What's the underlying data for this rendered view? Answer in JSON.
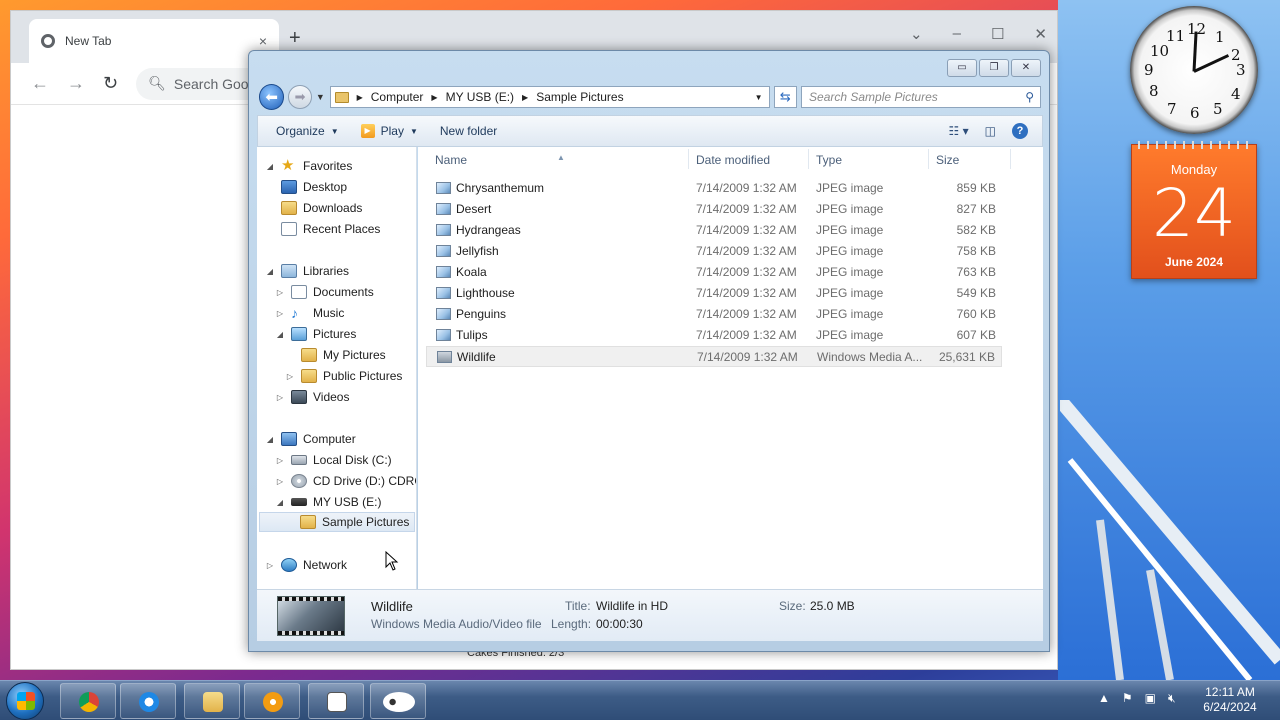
{
  "chrome": {
    "tab_title": "New Tab",
    "tab_close": "×",
    "new_tab": "+",
    "omnibox_placeholder": "Search Google",
    "status_text": "Cakes Finished: 2/3"
  },
  "explorer": {
    "breadcrumb": [
      "Computer",
      "MY USB (E:)",
      "Sample Pictures"
    ],
    "search_placeholder": "Search Sample Pictures",
    "toolbar": {
      "organize_label": "Organize",
      "play_label": "Play",
      "new_folder_label": "New folder"
    },
    "nav_tree": [
      {
        "label": "Favorites",
        "icon": "star-icon"
      },
      {
        "label": "Desktop",
        "icon": "desktop-icon"
      },
      {
        "label": "Downloads",
        "icon": "folder-icon"
      },
      {
        "label": "Recent Places",
        "icon": "recent-places-icon"
      },
      {
        "label": "Libraries",
        "icon": "library-icon"
      },
      {
        "label": "Documents",
        "icon": "document-icon"
      },
      {
        "label": "Music",
        "icon": "music-icon"
      },
      {
        "label": "Pictures",
        "icon": "pictures-icon"
      },
      {
        "label": "My Pictures",
        "icon": "folder-icon"
      },
      {
        "label": "Public Pictures",
        "icon": "folder-icon"
      },
      {
        "label": "Videos",
        "icon": "video-icon"
      },
      {
        "label": "Computer",
        "icon": "computer-icon"
      },
      {
        "label": "Local Disk (C:)",
        "icon": "drive-icon"
      },
      {
        "label": "CD Drive (D:) CDROM",
        "icon": "cd-icon"
      },
      {
        "label": "MY USB (E:)",
        "icon": "usb-drive-icon"
      },
      {
        "label": "Sample Pictures",
        "icon": "folder-icon"
      },
      {
        "label": "Network",
        "icon": "network-icon"
      }
    ],
    "columns": {
      "name": "Name",
      "date": "Date modified",
      "type": "Type",
      "size": "Size"
    },
    "files": [
      {
        "name": "Chrysanthemum",
        "date": "7/14/2009 1:32 AM",
        "type": "JPEG image",
        "size": "859 KB"
      },
      {
        "name": "Desert",
        "date": "7/14/2009 1:32 AM",
        "type": "JPEG image",
        "size": "827 KB"
      },
      {
        "name": "Hydrangeas",
        "date": "7/14/2009 1:32 AM",
        "type": "JPEG image",
        "size": "582 KB"
      },
      {
        "name": "Jellyfish",
        "date": "7/14/2009 1:32 AM",
        "type": "JPEG image",
        "size": "758 KB"
      },
      {
        "name": "Koala",
        "date": "7/14/2009 1:32 AM",
        "type": "JPEG image",
        "size": "763 KB"
      },
      {
        "name": "Lighthouse",
        "date": "7/14/2009 1:32 AM",
        "type": "JPEG image",
        "size": "549 KB"
      },
      {
        "name": "Penguins",
        "date": "7/14/2009 1:32 AM",
        "type": "JPEG image",
        "size": "760 KB"
      },
      {
        "name": "Tulips",
        "date": "7/14/2009 1:32 AM",
        "type": "JPEG image",
        "size": "607 KB"
      },
      {
        "name": "Wildlife",
        "date": "7/14/2009 1:32 AM",
        "type": "Windows Media A...",
        "size": "25,631 KB"
      }
    ],
    "details": {
      "name": "Wildlife",
      "file_type": "Windows Media Audio/Video file",
      "title_label": "Title:",
      "title_value": "Wildlife in HD",
      "length_label": "Length:",
      "length_value": "00:00:30",
      "size_label": "Size:",
      "size_value": "25.0 MB"
    }
  },
  "gadgets": {
    "calendar_day": "Monday",
    "calendar_date": "24",
    "calendar_month_year": "June 2024",
    "clock_numbers": [
      "12",
      "1",
      "2",
      "3",
      "4",
      "5",
      "6",
      "7",
      "8",
      "9",
      "10",
      "11"
    ]
  },
  "taskbar": {
    "time": "12:11 AM",
    "date": "6/24/2024",
    "apps": [
      "chrome-icon",
      "internet-explorer-icon",
      "windows-explorer-icon",
      "media-player-icon",
      "solitaire-icon",
      "eyes-icon"
    ]
  },
  "colors": {
    "calendar_orange": "#e2501c",
    "selection_blue": "#dde8f4",
    "taskbar_blue": "#3d5c86"
  }
}
